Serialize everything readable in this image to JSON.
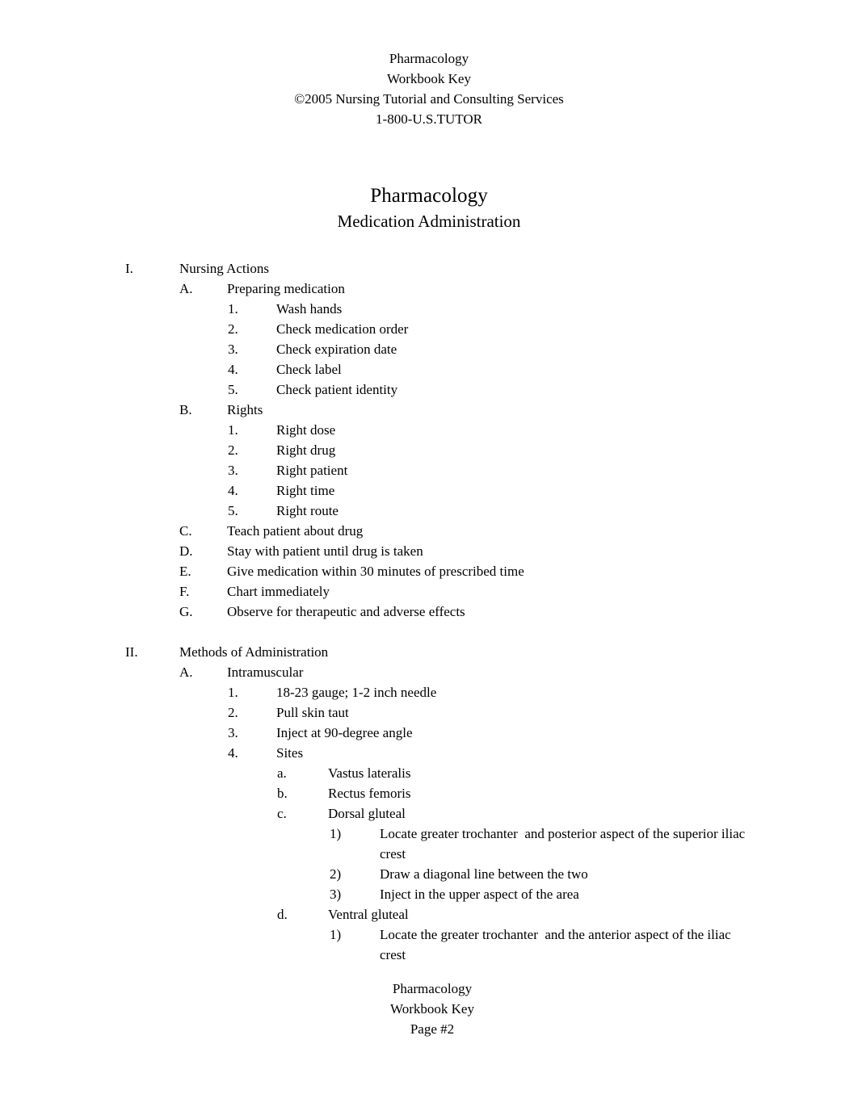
{
  "header": {
    "lines": [
      "Pharmacology",
      "Workbook Key",
      "©2005 Nursing Tutorial and Consulting Services",
      "1-800-U.S.TUTOR"
    ]
  },
  "title": {
    "main": "Pharmacology",
    "sub": "Medication Administration"
  },
  "outline": [
    {
      "level": 1,
      "marker": "I.",
      "text": "Nursing Actions",
      "gap": false
    },
    {
      "level": 2,
      "marker": "A.",
      "text": "Preparing medication",
      "gap": false
    },
    {
      "level": 3,
      "marker": "1.",
      "text": "Wash hands",
      "gap": false
    },
    {
      "level": 3,
      "marker": "2.",
      "text": "Check medication order",
      "gap": false
    },
    {
      "level": 3,
      "marker": "3.",
      "text": "Check expiration date",
      "gap": false
    },
    {
      "level": 3,
      "marker": "4.",
      "text": "Check label",
      "gap": false
    },
    {
      "level": 3,
      "marker": "5.",
      "text": "Check patient identity",
      "gap": false
    },
    {
      "level": 2,
      "marker": "B.",
      "text": "Rights",
      "gap": false
    },
    {
      "level": 3,
      "marker": "1.",
      "text": "Right dose",
      "gap": false
    },
    {
      "level": 3,
      "marker": "2.",
      "text": "Right drug",
      "gap": false
    },
    {
      "level": 3,
      "marker": "3.",
      "text": "Right patient",
      "gap": false
    },
    {
      "level": 3,
      "marker": "4.",
      "text": "Right time",
      "gap": false
    },
    {
      "level": 3,
      "marker": "5.",
      "text": "Right route",
      "gap": false
    },
    {
      "level": 2,
      "marker": "C.",
      "text": "Teach patient about drug",
      "gap": false
    },
    {
      "level": 2,
      "marker": "D.",
      "text": "Stay with patient until drug is taken",
      "gap": false
    },
    {
      "level": 2,
      "marker": "E.",
      "text": "Give medication within 30 minutes of prescribed time",
      "gap": false
    },
    {
      "level": 2,
      "marker": "F.",
      "text": "Chart immediately",
      "gap": false
    },
    {
      "level": 2,
      "marker": "G.",
      "text": "Observe for therapeutic and adverse effects",
      "gap": false
    },
    {
      "level": 1,
      "marker": "II.",
      "text": "Methods of Administration",
      "gap": true
    },
    {
      "level": 2,
      "marker": "A.",
      "text": "Intramuscular",
      "gap": false
    },
    {
      "level": 3,
      "marker": "1.",
      "text": "18-23 gauge; 1-2 inch needle",
      "gap": false
    },
    {
      "level": 3,
      "marker": "2.",
      "text": "Pull skin taut",
      "gap": false
    },
    {
      "level": 3,
      "marker": "3.",
      "text": "Inject at 90-degree angle",
      "gap": false
    },
    {
      "level": 3,
      "marker": "4.",
      "text": "Sites",
      "gap": false
    },
    {
      "level": 4,
      "marker": "a.",
      "text": "Vastus lateralis",
      "gap": false
    },
    {
      "level": 4,
      "marker": "b.",
      "text": "Rectus femoris",
      "gap": false
    },
    {
      "level": 4,
      "marker": "c.",
      "text": "Dorsal gluteal",
      "gap": false
    },
    {
      "level": 5,
      "marker": "1)",
      "text": "Locate greater trochanter  and posterior aspect of the superior iliac crest",
      "gap": false
    },
    {
      "level": 5,
      "marker": "2)",
      "text": "Draw a diagonal line between the two",
      "gap": false
    },
    {
      "level": 5,
      "marker": "3)",
      "text": "Inject in the upper aspect of the area",
      "gap": false
    },
    {
      "level": 4,
      "marker": "d.",
      "text": "Ventral gluteal",
      "gap": false
    },
    {
      "level": 5,
      "marker": "1)",
      "text": "Locate the greater trochanter  and the anterior aspect of the iliac crest",
      "gap": false
    }
  ],
  "footer": {
    "lines": [
      "Pharmacology",
      "Workbook Key",
      "Page #2"
    ]
  }
}
